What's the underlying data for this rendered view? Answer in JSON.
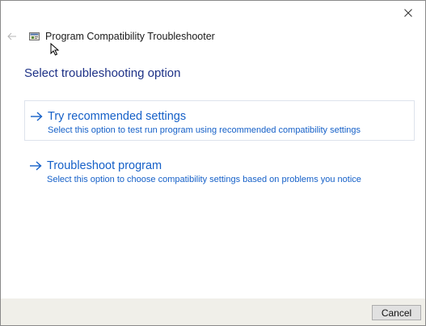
{
  "window": {
    "title": "Program Compatibility Troubleshooter",
    "close_icon": "close-icon",
    "back_icon": "back-arrow-icon",
    "app_icon": "program-compatibility-icon"
  },
  "main": {
    "heading": "Select troubleshooting option",
    "options": [
      {
        "title": "Try recommended settings",
        "description": "Select this option to test run program using recommended compatibility settings",
        "icon": "arrow-right-icon"
      },
      {
        "title": "Troubleshoot program",
        "description": "Select this option to choose compatibility settings based on problems you notice",
        "icon": "arrow-right-icon"
      }
    ]
  },
  "footer": {
    "cancel_label": "Cancel"
  },
  "colors": {
    "heading": "#1e3287",
    "link": "#1560c8",
    "footer_bg": "#f0efe9"
  }
}
